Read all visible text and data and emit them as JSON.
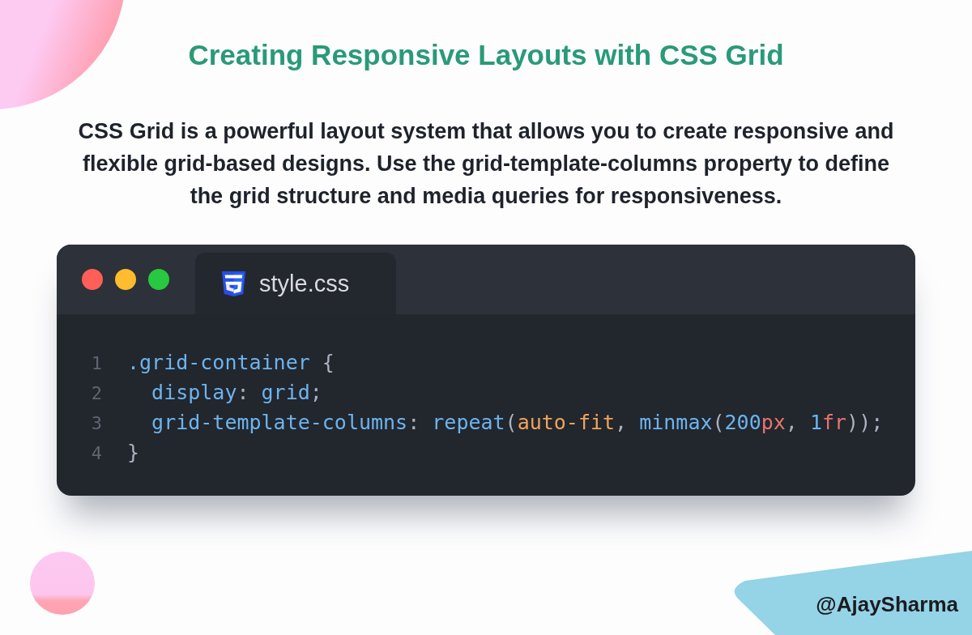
{
  "title": "Creating Responsive Layouts with CSS Grid",
  "intro": "CSS Grid is a powerful layout system that allows you to create responsive and flexible grid-based designs. Use the grid-template-columns property to define the grid structure and media queries for responsiveness.",
  "editor": {
    "window_controls": [
      {
        "color": "#ff5f57"
      },
      {
        "color": "#febc2e"
      },
      {
        "color": "#28c840"
      }
    ],
    "tabs": [
      {
        "label": "style.css",
        "selected": true
      }
    ],
    "lines": [
      {
        "number": "1",
        "tokens": [
          {
            "text": ".grid-container",
            "kind": "selector"
          },
          {
            "text": " {",
            "kind": "punct"
          }
        ],
        "children": [
          {
            "number": "2",
            "tokens": [
              {
                "text": "display",
                "kind": "property"
              },
              {
                "text": ": ",
                "kind": "punct"
              },
              {
                "text": "grid",
                "kind": "value"
              },
              {
                "text": ";",
                "kind": "punct"
              }
            ]
          },
          {
            "number": "3",
            "tokens": [
              {
                "text": "grid-template-columns",
                "kind": "property"
              },
              {
                "text": ": ",
                "kind": "punct"
              },
              {
                "text": "repeat",
                "kind": "function"
              },
              {
                "text": "(",
                "kind": "punct"
              },
              {
                "text": "auto-fit",
                "kind": "keyword"
              },
              {
                "text": ", ",
                "kind": "punct"
              },
              {
                "text": "minmax",
                "kind": "function"
              },
              {
                "text": "(",
                "kind": "punct"
              },
              {
                "text": "200",
                "kind": "number"
              },
              {
                "text": "px",
                "kind": "unit"
              },
              {
                "text": ", ",
                "kind": "punct"
              },
              {
                "text": "1",
                "kind": "number"
              },
              {
                "text": "fr",
                "kind": "unit"
              },
              {
                "text": "));",
                "kind": "punct"
              }
            ]
          }
        ]
      },
      {
        "number": "4",
        "tokens": [
          {
            "text": "}",
            "kind": "punct"
          }
        ]
      }
    ]
  },
  "handle": "@AjaySharma"
}
